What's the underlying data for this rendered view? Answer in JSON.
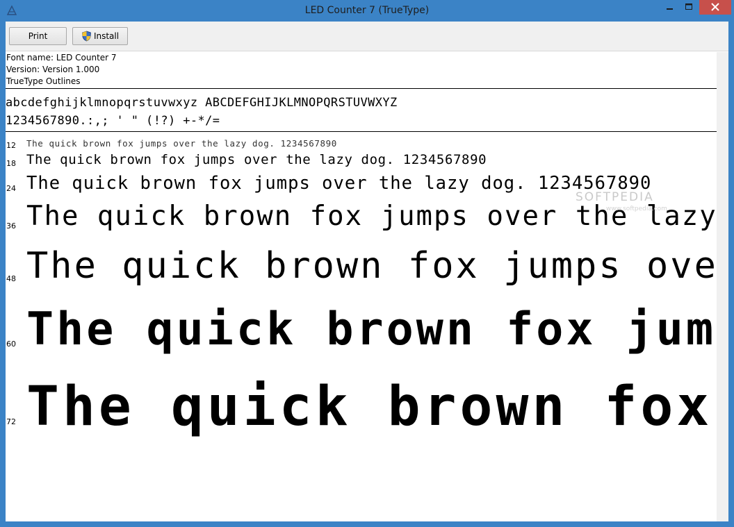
{
  "window": {
    "title": "LED Counter 7 (TrueType)"
  },
  "toolbar": {
    "print_label": "Print",
    "install_label": "Install"
  },
  "info": {
    "font_name": "Font name: LED Counter 7",
    "version": "Version: Version 1.000",
    "outlines": "TrueType Outlines"
  },
  "charset": {
    "line1": "abcdefghijklmnopqrstuvwxyz ABCDEFGHIJKLMNOPQRSTUVWXYZ",
    "line2": "1234567890.:,; ' \" (!?) +-*/="
  },
  "waterfall": [
    {
      "size": "12",
      "text": "The quick brown fox jumps over the lazy dog. 1234567890"
    },
    {
      "size": "18",
      "text": "The quick brown fox jumps over the lazy dog. 1234567890"
    },
    {
      "size": "24",
      "text": "The quick brown fox jumps over the lazy dog. 1234567890"
    },
    {
      "size": "36",
      "text": "The quick brown fox jumps over the lazy"
    },
    {
      "size": "48",
      "text": "The quick brown fox jumps over"
    },
    {
      "size": "60",
      "text": "The quick brown fox jump"
    },
    {
      "size": "72",
      "text": "The quick brown fox"
    }
  ],
  "watermark": {
    "text": "SOFTPEDIA",
    "sub": "www.softpedia.com"
  },
  "colors": {
    "frame": "#3b83c6",
    "close": "#c7504b",
    "toolbar": "#f0f0f0"
  }
}
